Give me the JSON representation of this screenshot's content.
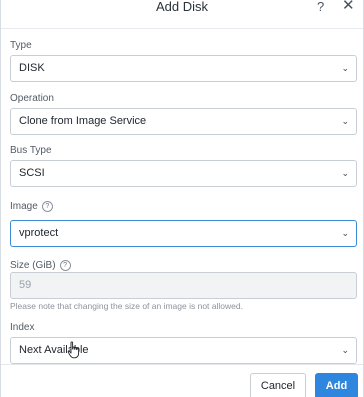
{
  "dialog": {
    "title": "Add Disk",
    "help_label": "?",
    "close_label": "✕"
  },
  "fields": {
    "type": {
      "label": "Type",
      "value": "DISK"
    },
    "operation": {
      "label": "Operation",
      "value": "Clone from Image Service"
    },
    "bus_type": {
      "label": "Bus Type",
      "value": "SCSI"
    },
    "image": {
      "label": "Image",
      "help": "?",
      "value": "vprotect"
    },
    "size": {
      "label": "Size (GiB)",
      "help": "?",
      "value": "59",
      "note": "Please note that changing the size of an image is not allowed."
    },
    "index": {
      "label": "Index",
      "value": "Next Available"
    }
  },
  "icons": {
    "chevron": "⌄",
    "chevron_name": "chevron-down-icon",
    "cursor_name": "hand-pointer-icon"
  },
  "footer": {
    "cancel_label": "Cancel",
    "add_label": "Add"
  },
  "colors": {
    "primary": "#2e86de",
    "active_border": "#3d8bd6"
  }
}
